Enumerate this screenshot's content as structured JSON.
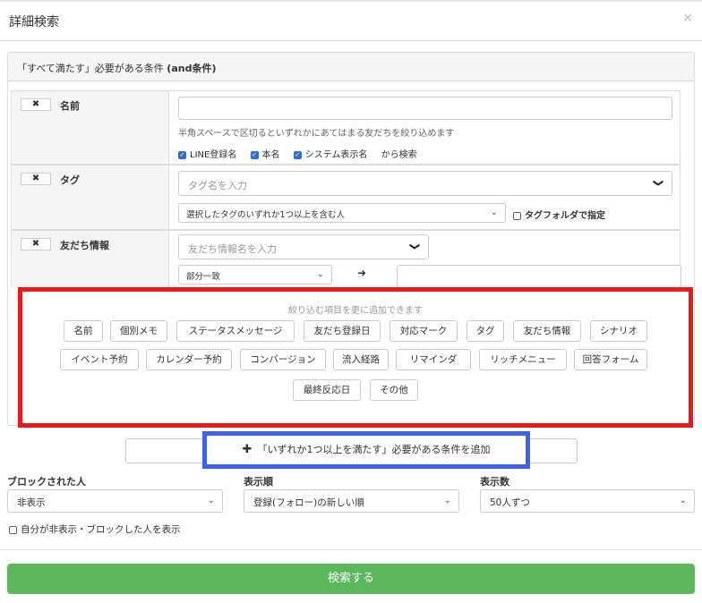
{
  "modal": {
    "title": "詳細検索",
    "close": "×"
  },
  "panel": {
    "header_prefix": "「すべて満たす」必要がある条件 ",
    "header_bold": "(and条件)"
  },
  "rows": {
    "remove_glyph": "✖",
    "name": {
      "label": "名前",
      "placeholder": "",
      "hint": "半角スペースで区切るといずれかにあてはまる友だちを絞り込めます",
      "checks": [
        "LINE登録名",
        "本名",
        "システム表示名"
      ],
      "suffix": "から検索"
    },
    "tag": {
      "label": "タグ",
      "placeholder": "タグ名を入力",
      "mode": "選択したタグのいずれか1つ以上を含む人",
      "folder_label": "タグフォルダで指定"
    },
    "friend_info": {
      "label": "友だち情報",
      "placeholder": "友だち情報名を入力",
      "match": "部分一致",
      "arrow": "➜"
    }
  },
  "add_items": {
    "hint": "絞り込む項目を更に追加できます",
    "row1": [
      "名前",
      "個別メモ",
      "ステータスメッセージ",
      "友だち登録日",
      "対応マーク",
      "タグ",
      "友だち情報",
      "シナリオ"
    ],
    "row2": [
      "イベント予約",
      "カレンダー予約",
      "コンバージョン",
      "流入経路",
      "リマインダ",
      "リッチメニュー",
      "回答フォーム"
    ],
    "row3": [
      "最終反応日",
      "その他"
    ]
  },
  "or_condition": {
    "plus": "✚",
    "label": "「いずれか1つ以上を満たす」必要がある条件を追加"
  },
  "filters": {
    "blocked": {
      "label": "ブロックされた人",
      "value": "非表示"
    },
    "order": {
      "label": "表示順",
      "value": "登録(フォロー)の新しい順"
    },
    "count": {
      "label": "表示数",
      "value": "50人ずつ"
    },
    "self_hidden": "自分が非表示・ブロックした人を表示"
  },
  "search_button": "検索する",
  "colors": {
    "highlight_red": "#e41c1c",
    "highlight_blue": "#3c63e8",
    "primary_green": "#5cb85c",
    "check_blue": "#2f6fd3"
  }
}
